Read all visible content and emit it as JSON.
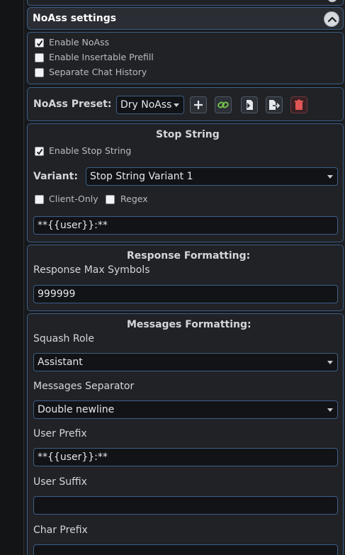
{
  "header": {
    "title": "NoAss settings"
  },
  "general": {
    "checkboxes": [
      {
        "label": "Enable NoAss",
        "checked": true
      },
      {
        "label": "Enable Insertable Prefill",
        "checked": false
      },
      {
        "label": "Separate Chat History",
        "checked": false
      }
    ]
  },
  "preset": {
    "label": "NoAss Preset:",
    "selected": "Dry NoAss",
    "buttons": [
      "plus-icon",
      "link-icon",
      "import-icon",
      "export-icon",
      "trash-icon"
    ]
  },
  "stop_string": {
    "title": "Stop String",
    "enable_label": "Enable Stop String",
    "enable_checked": true,
    "variant_label": "Variant:",
    "variant_selected": "Stop String Variant 1",
    "client_only_label": "Client-Only",
    "client_only_checked": false,
    "regex_label": "Regex",
    "regex_checked": false,
    "value": "**{{user}}:**"
  },
  "response": {
    "title": "Response Formatting:",
    "max_symbols_label": "Response Max Symbols",
    "max_symbols_value": "999999"
  },
  "messages": {
    "title": "Messages Formatting:",
    "squash_role_label": "Squash Role",
    "squash_role_value": "Assistant",
    "separator_label": "Messages Separator",
    "separator_value": "Double newline",
    "user_prefix_label": "User Prefix",
    "user_prefix_value": "**{{user}}:**",
    "user_suffix_label": "User Suffix",
    "user_suffix_value": "",
    "char_prefix_label": "Char Prefix",
    "char_prefix_value": ""
  }
}
